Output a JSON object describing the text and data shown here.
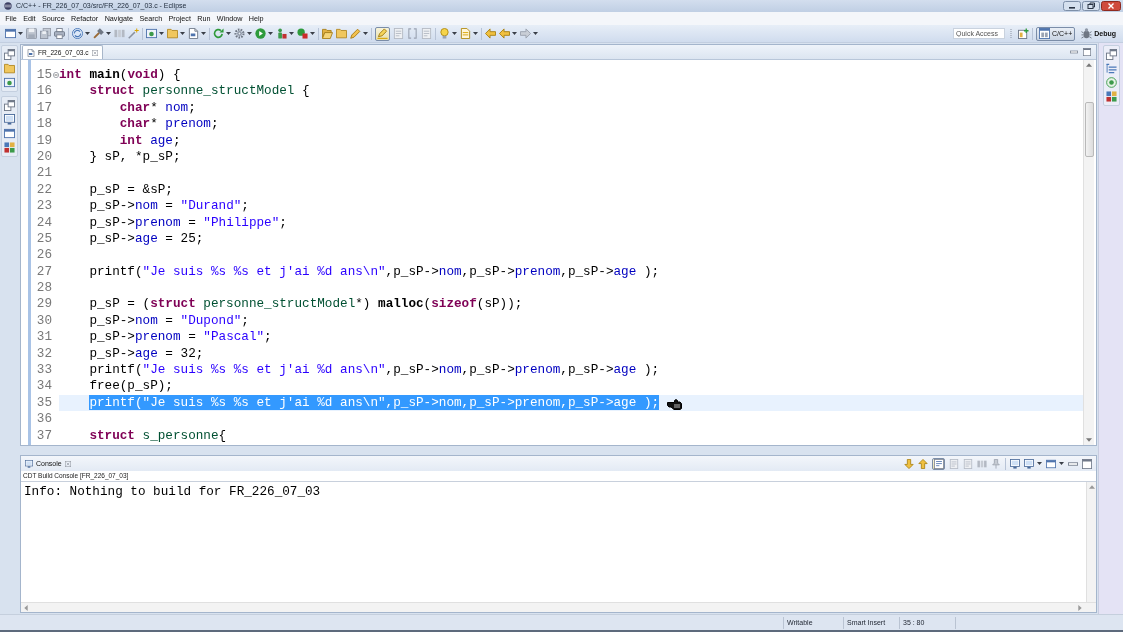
{
  "window": {
    "title": "C/C++ - FR_226_07_03/src/FR_226_07_03.c - Eclipse"
  },
  "menu": [
    "File",
    "Edit",
    "Source",
    "Refactor",
    "Navigate",
    "Search",
    "Project",
    "Run",
    "Window",
    "Help"
  ],
  "toolbar": {
    "toggle_on": true,
    "quick_access": {
      "placeholder": "Quick Access"
    },
    "perspectives": [
      {
        "label": "C/C++",
        "selected": true
      },
      {
        "label": "Debug",
        "selected": false
      }
    ]
  },
  "editor": {
    "tabs": [
      {
        "label": "FR_226_07_03.c",
        "selected": true
      }
    ],
    "lines": [
      {
        "number": "15",
        "foldable": true,
        "selected": false,
        "tokens": [
          {
            "kind": "keyword",
            "text": "int "
          },
          {
            "kind": "function",
            "text": "main"
          },
          {
            "kind": "plain",
            "text": "("
          },
          {
            "kind": "keyword",
            "text": "void"
          },
          {
            "kind": "plain",
            "text": ") {"
          }
        ]
      },
      {
        "number": "16",
        "foldable": false,
        "selected": false,
        "tokens": [
          {
            "kind": "keyword",
            "text": "    struct "
          },
          {
            "kind": "type",
            "text": "personne_structModel"
          },
          {
            "kind": "plain",
            "text": " {"
          }
        ]
      },
      {
        "number": "17",
        "foldable": false,
        "selected": false,
        "tokens": [
          {
            "kind": "keyword",
            "text": "        char"
          },
          {
            "kind": "plain",
            "text": "* "
          },
          {
            "kind": "field",
            "text": "nom"
          },
          {
            "kind": "plain",
            "text": ";"
          }
        ]
      },
      {
        "number": "18",
        "foldable": false,
        "selected": false,
        "tokens": [
          {
            "kind": "keyword",
            "text": "        char"
          },
          {
            "kind": "plain",
            "text": "* "
          },
          {
            "kind": "field",
            "text": "prenom"
          },
          {
            "kind": "plain",
            "text": ";"
          }
        ]
      },
      {
        "number": "19",
        "foldable": false,
        "selected": false,
        "tokens": [
          {
            "kind": "keyword",
            "text": "        int "
          },
          {
            "kind": "field",
            "text": "age"
          },
          {
            "kind": "plain",
            "text": ";"
          }
        ]
      },
      {
        "number": "20",
        "foldable": false,
        "selected": false,
        "tokens": [
          {
            "kind": "plain",
            "text": "    } sP, *p_sP;"
          }
        ]
      },
      {
        "number": "21",
        "foldable": false,
        "selected": false
      },
      {
        "number": "22",
        "foldable": false,
        "selected": false,
        "tokens": [
          {
            "kind": "plain",
            "text": "    p_sP = &sP;"
          }
        ]
      },
      {
        "number": "23",
        "foldable": false,
        "selected": false,
        "tokens": [
          {
            "kind": "plain",
            "text": "    p_sP->"
          },
          {
            "kind": "field",
            "text": "nom"
          },
          {
            "kind": "plain",
            "text": " = "
          },
          {
            "kind": "string",
            "text": "\"Durand\""
          },
          {
            "kind": "plain",
            "text": ";"
          }
        ]
      },
      {
        "number": "24",
        "foldable": false,
        "selected": false,
        "tokens": [
          {
            "kind": "plain",
            "text": "    p_sP->"
          },
          {
            "kind": "field",
            "text": "prenom"
          },
          {
            "kind": "plain",
            "text": " = "
          },
          {
            "kind": "string",
            "text": "\"Philippe\""
          },
          {
            "kind": "plain",
            "text": ";"
          }
        ]
      },
      {
        "number": "25",
        "foldable": false,
        "selected": false,
        "tokens": [
          {
            "kind": "plain",
            "text": "    p_sP->"
          },
          {
            "kind": "field",
            "text": "age"
          },
          {
            "kind": "plain",
            "text": " = 25;"
          }
        ]
      },
      {
        "number": "26",
        "foldable": false,
        "selected": false
      },
      {
        "number": "27",
        "foldable": false,
        "selected": false,
        "tokens": [
          {
            "kind": "plain",
            "text": "    printf("
          },
          {
            "kind": "string",
            "text": "\"Je suis %s %s et j'ai %d ans\\n\""
          },
          {
            "kind": "plain",
            "text": ",p_sP->"
          },
          {
            "kind": "field",
            "text": "nom"
          },
          {
            "kind": "plain",
            "text": ",p_sP->"
          },
          {
            "kind": "field",
            "text": "prenom"
          },
          {
            "kind": "plain",
            "text": ",p_sP->"
          },
          {
            "kind": "field",
            "text": "age"
          },
          {
            "kind": "plain",
            "text": " );"
          }
        ]
      },
      {
        "number": "28",
        "foldable": false,
        "selected": false
      },
      {
        "number": "29",
        "foldable": false,
        "selected": false,
        "tokens": [
          {
            "kind": "plain",
            "text": "    p_sP = ("
          },
          {
            "kind": "keyword",
            "text": "struct "
          },
          {
            "kind": "type",
            "text": "personne_structModel"
          },
          {
            "kind": "plain",
            "text": "*) "
          },
          {
            "kind": "function",
            "text": "malloc"
          },
          {
            "kind": "plain",
            "text": "("
          },
          {
            "kind": "keyword",
            "text": "sizeof"
          },
          {
            "kind": "plain",
            "text": "(sP));"
          }
        ]
      },
      {
        "number": "30",
        "foldable": false,
        "selected": false,
        "tokens": [
          {
            "kind": "plain",
            "text": "    p_sP->"
          },
          {
            "kind": "field",
            "text": "nom"
          },
          {
            "kind": "plain",
            "text": " = "
          },
          {
            "kind": "string",
            "text": "\"Dupond\""
          },
          {
            "kind": "plain",
            "text": ";"
          }
        ]
      },
      {
        "number": "31",
        "foldable": false,
        "selected": false,
        "tokens": [
          {
            "kind": "plain",
            "text": "    p_sP->"
          },
          {
            "kind": "field",
            "text": "prenom"
          },
          {
            "kind": "plain",
            "text": " = "
          },
          {
            "kind": "string",
            "text": "\"Pascal\""
          },
          {
            "kind": "plain",
            "text": ";"
          }
        ]
      },
      {
        "number": "32",
        "foldable": false,
        "selected": false,
        "tokens": [
          {
            "kind": "plain",
            "text": "    p_sP->"
          },
          {
            "kind": "field",
            "text": "age"
          },
          {
            "kind": "plain",
            "text": " = 32;"
          }
        ]
      },
      {
        "number": "33",
        "foldable": false,
        "selected": false,
        "tokens": [
          {
            "kind": "plain",
            "text": "    printf("
          },
          {
            "kind": "string",
            "text": "\"Je suis %s %s et j'ai %d ans\\n\""
          },
          {
            "kind": "plain",
            "text": ",p_sP->"
          },
          {
            "kind": "field",
            "text": "nom"
          },
          {
            "kind": "plain",
            "text": ",p_sP->"
          },
          {
            "kind": "field",
            "text": "prenom"
          },
          {
            "kind": "plain",
            "text": ",p_sP->"
          },
          {
            "kind": "field",
            "text": "age"
          },
          {
            "kind": "plain",
            "text": " );"
          }
        ]
      },
      {
        "number": "34",
        "foldable": false,
        "selected": false,
        "tokens": [
          {
            "kind": "plain",
            "text": "    free(p_sP);"
          }
        ]
      },
      {
        "number": "35",
        "foldable": false,
        "selected": true,
        "tokens": [
          {
            "kind": "plain",
            "text": "    printf("
          },
          {
            "kind": "string",
            "text": "\"Je suis %s %s et j'ai %d ans\\n\""
          },
          {
            "kind": "plain",
            "text": ",p_sP->"
          },
          {
            "kind": "field",
            "text": "nom"
          },
          {
            "kind": "plain",
            "text": ",p_sP->"
          },
          {
            "kind": "field",
            "text": "prenom"
          },
          {
            "kind": "plain",
            "text": ",p_sP->"
          },
          {
            "kind": "field",
            "text": "age"
          },
          {
            "kind": "plain",
            "text": " );"
          }
        ]
      },
      {
        "number": "36",
        "foldable": false,
        "selected": false
      },
      {
        "number": "37",
        "foldable": false,
        "selected": false,
        "tokens": [
          {
            "kind": "keyword",
            "text": "    struct "
          },
          {
            "kind": "type",
            "text": "s_personne"
          },
          {
            "kind": "plain",
            "text": "{"
          }
        ]
      }
    ]
  },
  "console": {
    "tab": "Console",
    "title": "CDT Build Console [FR_226_07_03]",
    "toggle_on": true,
    "output": [
      "Info: Nothing to build for FR_226_07_03"
    ]
  },
  "status_bar": [
    "Writable",
    "Smart Insert",
    "35 : 80"
  ]
}
